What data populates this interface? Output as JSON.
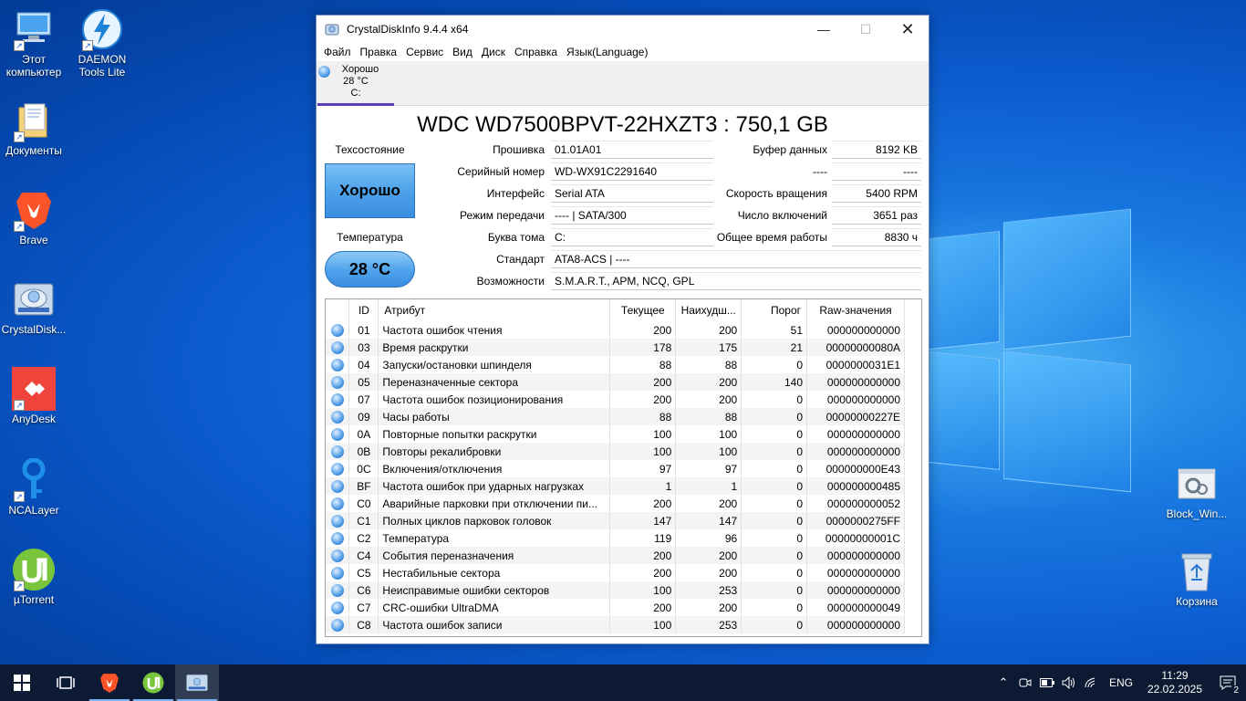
{
  "desktop": {
    "icons_left": [
      {
        "label": "Этот компьютер",
        "icon": "this-pc-icon"
      },
      {
        "label": "DAEMON Tools Lite",
        "icon": "daemon-tools-icon"
      },
      {
        "label": "Документы",
        "icon": "documents-folder-icon"
      },
      {
        "label": "Brave",
        "icon": "brave-icon"
      },
      {
        "label": "CrystalDisk...",
        "icon": "crystaldisk-icon"
      },
      {
        "label": "AnyDesk",
        "icon": "anydesk-icon"
      },
      {
        "label": "NCALayer",
        "icon": "ncalayer-icon"
      },
      {
        "label": "µTorrent",
        "icon": "utorrent-icon"
      }
    ],
    "icons_right": [
      {
        "label": "Block_Win...",
        "icon": "settings-file-icon"
      },
      {
        "label": "Корзина",
        "icon": "recycle-bin-icon"
      }
    ]
  },
  "window": {
    "title": "CrystalDiskInfo 9.4.4 x64",
    "menu": [
      "Файл",
      "Правка",
      "Сервис",
      "Вид",
      "Диск",
      "Справка",
      "Язык(Language)"
    ],
    "disk_tab": {
      "status": "Хорошо",
      "temp": "28 °C",
      "drive": "C:"
    },
    "model": "WDC WD7500BPVT-22HXZT3 : 750,1 GB",
    "health_label": "Техсостояние",
    "health_value": "Хорошо",
    "temp_label": "Температура",
    "temp_value": "28 °C",
    "firmware_label": "Прошивка",
    "firmware": "01.01A01",
    "serial_label": "Серийный номер",
    "serial": "WD-WX91C2291640",
    "interface_label": "Интерфейс",
    "interface": "Serial ATA",
    "transfer_label": "Режим передачи",
    "transfer": "---- | SATA/300",
    "volume_label": "Буква тома",
    "volume": "C:",
    "standard_label": "Стандарт",
    "standard": "ATA8-ACS | ----",
    "features_label": "Возможности",
    "features": "S.M.A.R.T., APM, NCQ, GPL",
    "buffer_label": "Буфер данных",
    "buffer": "8192 KB",
    "blank_label": "----",
    "blank_value": "----",
    "rpm_label": "Скорость вращения",
    "rpm": "5400 RPM",
    "power_count_label": "Число включений",
    "power_count": "3651 раз",
    "power_hours_label": "Общее время работы",
    "power_hours": "8830 ч",
    "table": {
      "headers": [
        "ID",
        "Атрибут",
        "Текущее",
        "Наихудш...",
        "Порог",
        "Raw-значения"
      ],
      "rows": [
        [
          "01",
          "Частота ошибок чтения",
          "200",
          "200",
          "51",
          "000000000000"
        ],
        [
          "03",
          "Время раскрутки",
          "178",
          "175",
          "21",
          "00000000080A"
        ],
        [
          "04",
          "Запуски/остановки шпинделя",
          "88",
          "88",
          "0",
          "0000000031E1"
        ],
        [
          "05",
          "Переназначенные сектора",
          "200",
          "200",
          "140",
          "000000000000"
        ],
        [
          "07",
          "Частота ошибок позиционирования",
          "200",
          "200",
          "0",
          "000000000000"
        ],
        [
          "09",
          "Часы работы",
          "88",
          "88",
          "0",
          "00000000227E"
        ],
        [
          "0A",
          "Повторные попытки раскрутки",
          "100",
          "100",
          "0",
          "000000000000"
        ],
        [
          "0B",
          "Повторы рекалибровки",
          "100",
          "100",
          "0",
          "000000000000"
        ],
        [
          "0C",
          "Включения/отключения",
          "97",
          "97",
          "0",
          "000000000E43"
        ],
        [
          "BF",
          "Частота ошибок при ударных нагрузках",
          "1",
          "1",
          "0",
          "000000000485"
        ],
        [
          "C0",
          "Аварийные парковки при отключении пи...",
          "200",
          "200",
          "0",
          "000000000052"
        ],
        [
          "C1",
          "Полных циклов парковок головок",
          "147",
          "147",
          "0",
          "0000000275FF"
        ],
        [
          "C2",
          "Температура",
          "119",
          "96",
          "0",
          "00000000001C"
        ],
        [
          "C4",
          "События переназначения",
          "200",
          "200",
          "0",
          "000000000000"
        ],
        [
          "C5",
          "Нестабильные сектора",
          "200",
          "200",
          "0",
          "000000000000"
        ],
        [
          "C6",
          "Неисправимые ошибки секторов",
          "100",
          "253",
          "0",
          "000000000000"
        ],
        [
          "C7",
          "CRC-ошибки UltraDMA",
          "200",
          "200",
          "0",
          "000000000049"
        ],
        [
          "C8",
          "Частота ошибок записи",
          "100",
          "253",
          "0",
          "000000000000"
        ]
      ]
    }
  },
  "taskbar": {
    "lang": "ENG",
    "time": "11:29",
    "date": "22.02.2025",
    "notifications": "2"
  },
  "colors": {
    "good_blue": "#4ea2ea",
    "taskbar": "#0c1a33",
    "desktop": "#0c5ccf"
  }
}
